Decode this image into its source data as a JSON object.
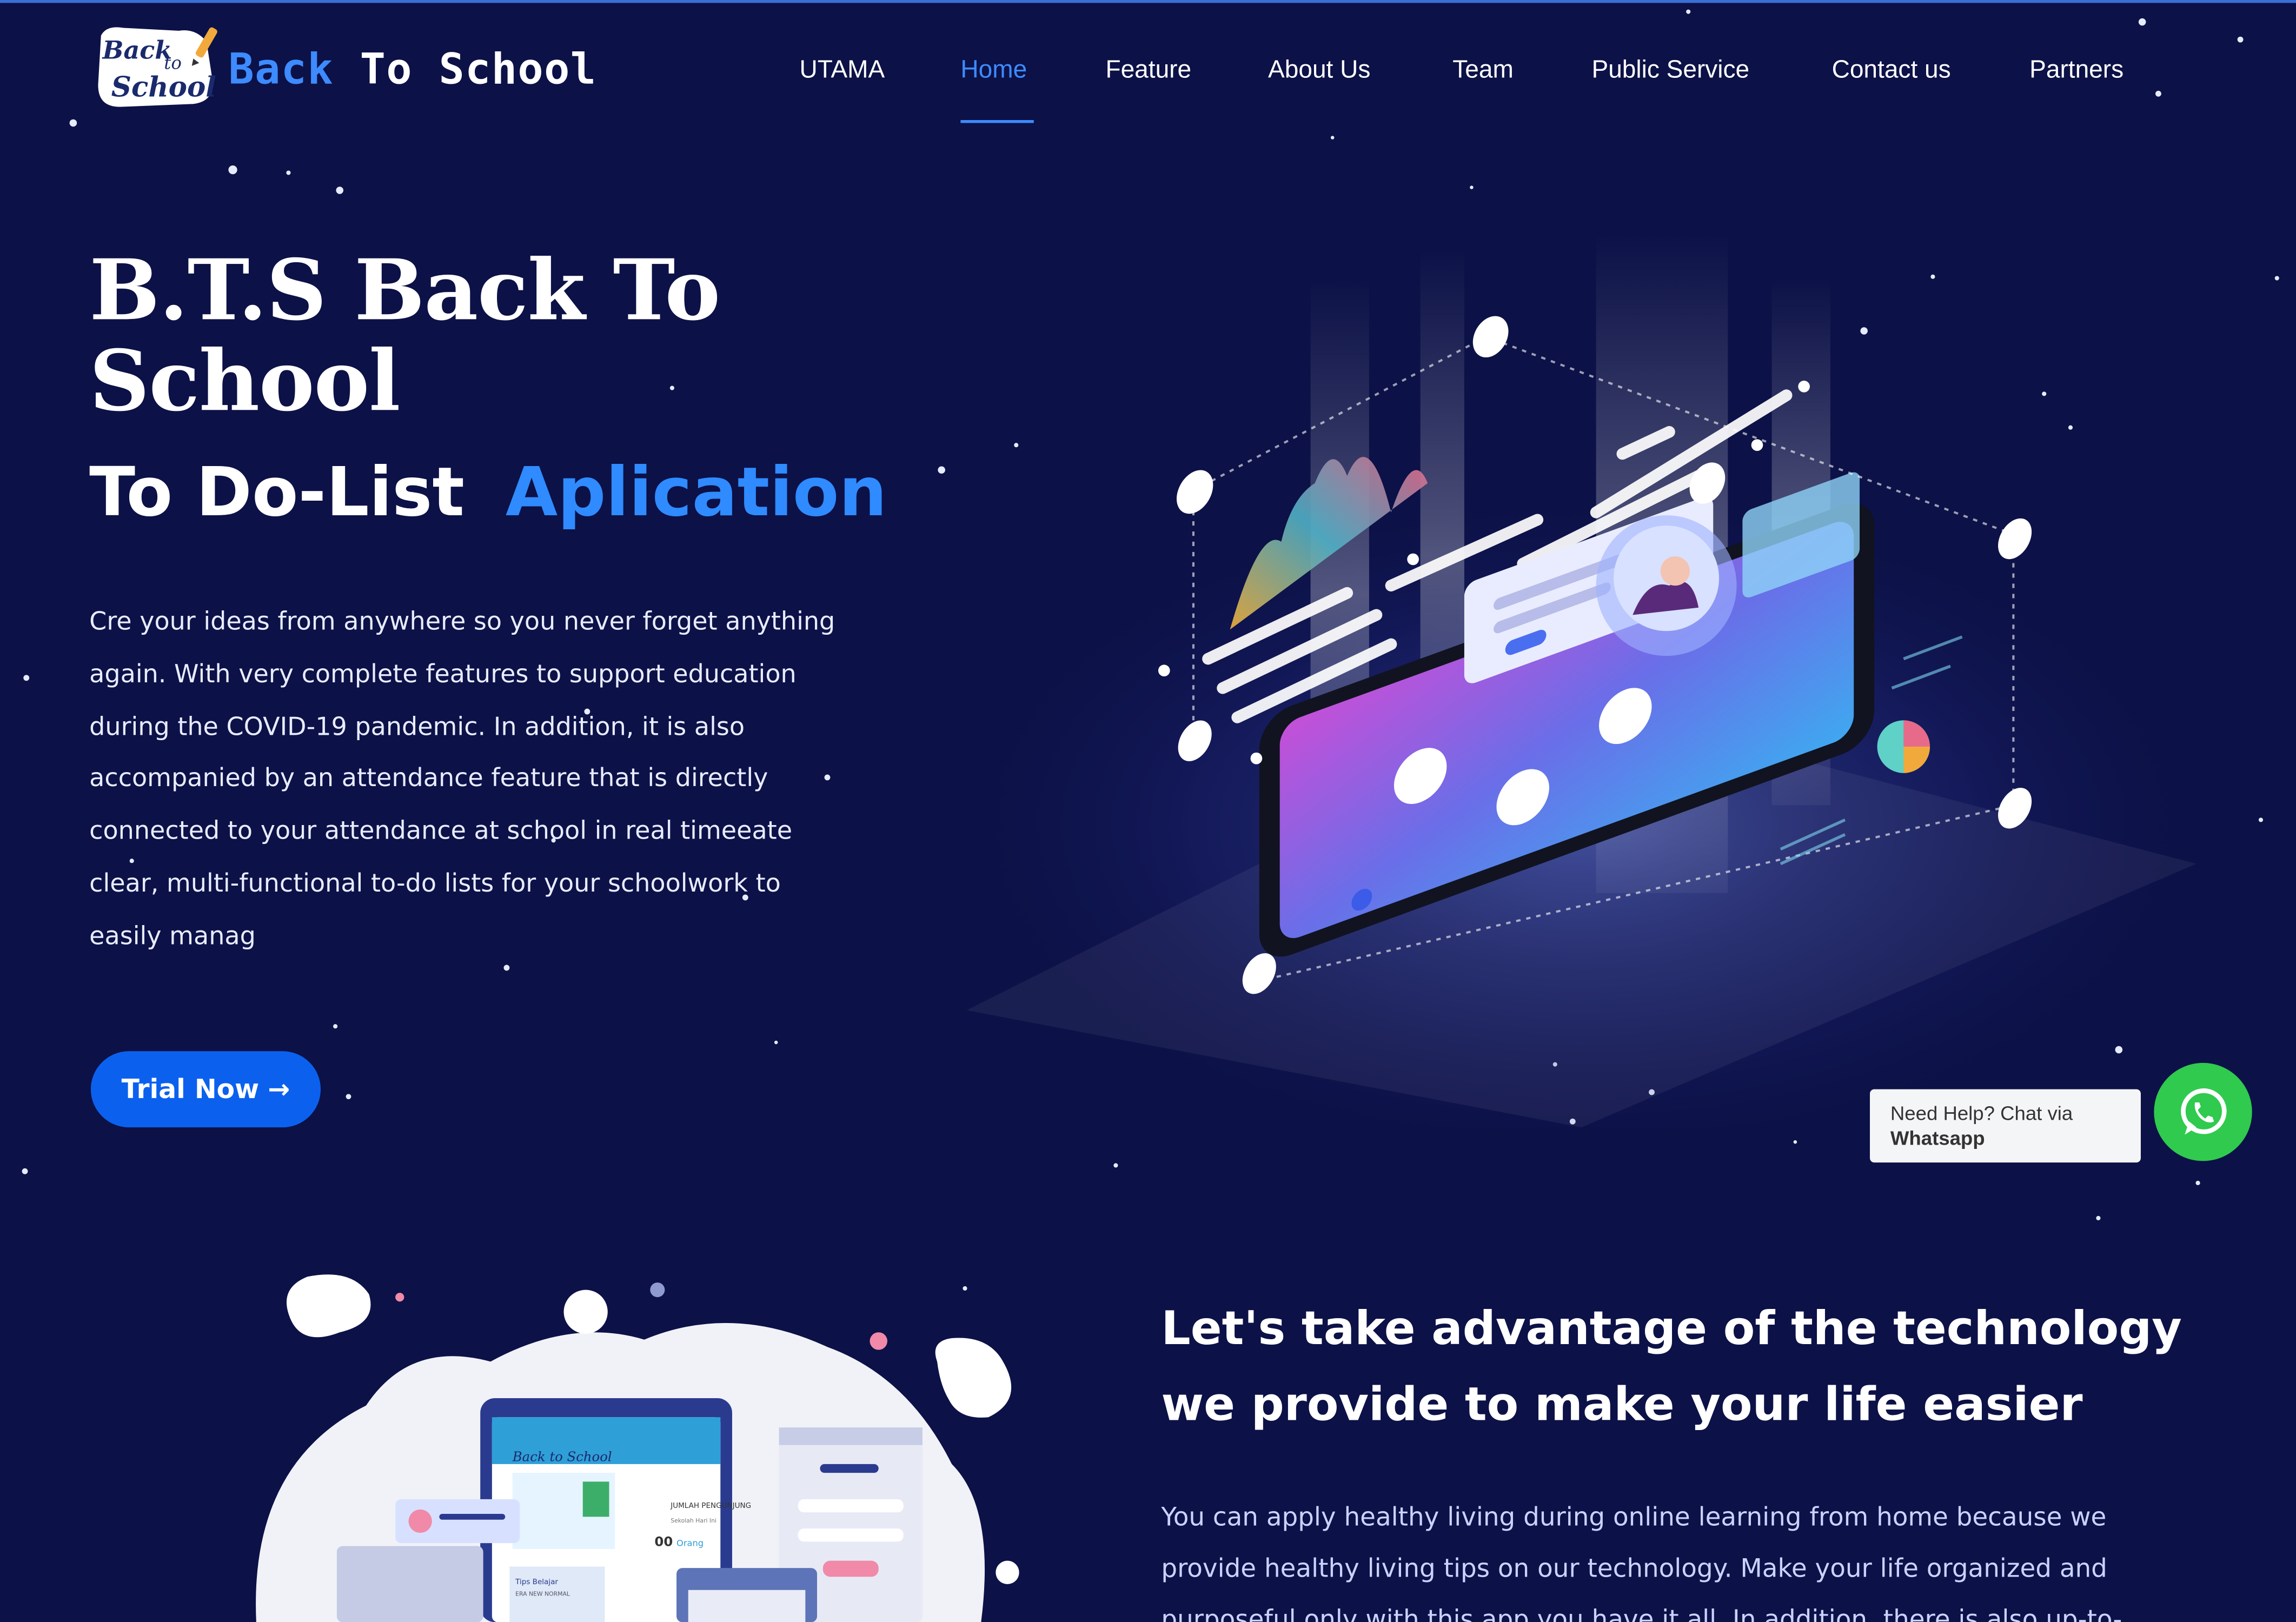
{
  "header": {
    "brand_part1": "Back",
    "brand_part2": "To School",
    "logo_text": "Back to School",
    "nav": [
      "UTAMA",
      "Home",
      "Feature",
      "About Us",
      "Team",
      "Public Service",
      "Contact us",
      "Partners"
    ],
    "active_nav": "Home"
  },
  "hero": {
    "title": "B.T.S Back To School",
    "subtitle_white": "To Do-List",
    "subtitle_blue": "Aplication",
    "description": "Cre your ideas from anywhere so you never forget anything again. With very complete features to support education during the COVID-19 pandemic. In addition, it is also accompanied by an attendance feature that is directly connected to your attendance at school in real timeeate clear, multi-functional to-do lists for your schoolwork to easily manag",
    "cta_label": "Trial Now",
    "cta_arrow": "→"
  },
  "whatsapp": {
    "line1": "Need Help? Chat via",
    "line2": "Whatsapp",
    "icon": "whatsapp-icon"
  },
  "section2": {
    "title": "Let's take advantage of the technology we provide to make your life easier",
    "text": "You can apply healthy living during online learning from home because we provide healthy living tips on our technology. Make your life organized and purposeful only with this app you have it all. In addition, there is also up-to-",
    "app_screen": {
      "header_label": "JUMLAH PENGUNJUNG",
      "sub_label": "Sekolah Hari Ini",
      "count": "00",
      "count_unit": "Orang",
      "card_label": "Tips Belajar",
      "card_sub": "ERA NEW NORMAL"
    }
  },
  "colors": {
    "background": "#0c1147",
    "accent": "#3d8bff",
    "button": "#0b61ee",
    "whatsapp": "#2fca4e"
  }
}
